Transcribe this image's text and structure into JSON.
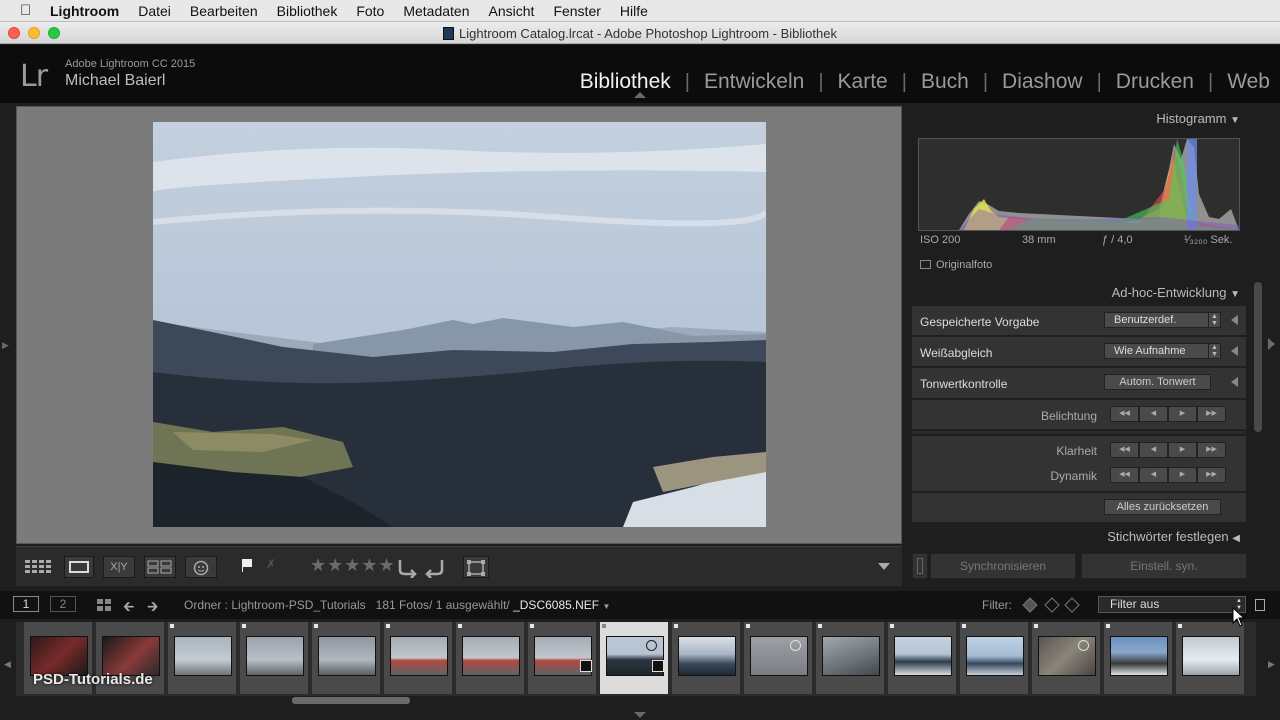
{
  "menubar": {
    "app_name": "Lightroom",
    "items": [
      "Datei",
      "Bearbeiten",
      "Bibliothek",
      "Foto",
      "Metadaten",
      "Ansicht",
      "Fenster",
      "Hilfe"
    ]
  },
  "window": {
    "title": "Lightroom Catalog.lrcat - Adobe Photoshop Lightroom - Bibliothek"
  },
  "identity": {
    "logo": "Lr",
    "product": "Adobe Lightroom CC 2015",
    "user": "Michael Baierl"
  },
  "modules": [
    {
      "label": "Bibliothek",
      "active": true
    },
    {
      "label": "Entwickeln"
    },
    {
      "label": "Karte"
    },
    {
      "label": "Buch"
    },
    {
      "label": "Diashow"
    },
    {
      "label": "Drucken"
    },
    {
      "label": "Web"
    }
  ],
  "toolbar": {
    "xy_label": "X|Y",
    "stars": "★★★★★"
  },
  "histogram": {
    "header": "Histogramm",
    "iso": "ISO 200",
    "focal": "38 mm",
    "aperture": "ƒ / 4,0",
    "shutter": "¹⁄₃₂₀₀ Sek.",
    "original_label": "Originalfoto"
  },
  "quick_develop": {
    "header": "Ad-hoc-Entwicklung",
    "preset_label": "Gespeicherte Vorgabe",
    "preset_value": "Benutzerdef.",
    "wb_label": "Weißabgleich",
    "wb_value": "Wie Aufnahme",
    "tone_label": "Tonwertkontrolle",
    "auto_tone": "Autom. Tonwert",
    "exposure": "Belichtung",
    "clarity": "Klarheit",
    "vibrance": "Dynamik",
    "reset_all": "Alles zurücksetzen"
  },
  "keywording": {
    "header": "Stichwörter festlegen"
  },
  "sync": {
    "sync_label": "Synchronisieren",
    "sync_settings": "Einstell. syn."
  },
  "filmstrip_bar": {
    "win1": "1",
    "win2": "2",
    "path": "Ordner : Lightroom-PSD_Tutorials",
    "count": "181 Fotos/",
    "selected": "1 ausgewählt/",
    "filename": "_DSC6085.NEF",
    "filter_label": "Filter:",
    "filter_value": "Filter aus"
  },
  "watermark": "PSD-Tutorials.de",
  "colors": {
    "accent": "#f2f2f2",
    "panel": "#333333",
    "background": "#1e1e1e"
  }
}
